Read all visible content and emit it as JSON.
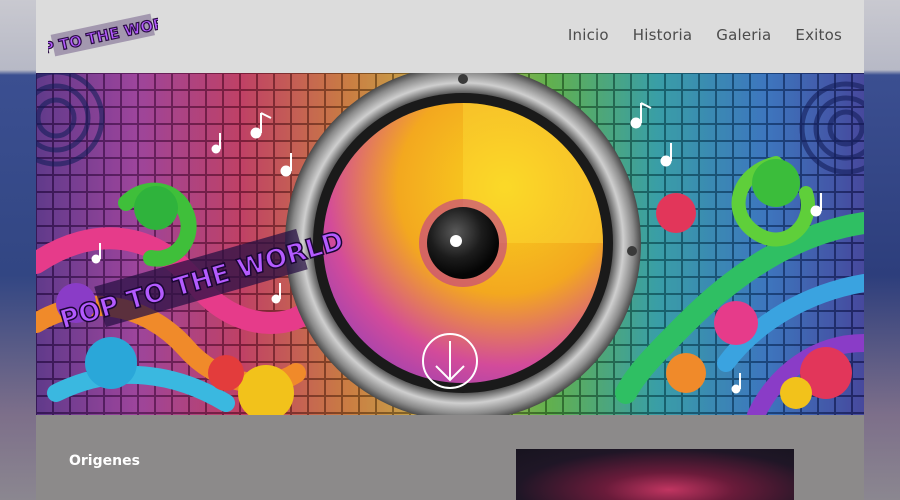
{
  "brand": {
    "logo_text": "POP TO THE WORLD"
  },
  "nav": {
    "items": [
      {
        "label": "Inicio"
      },
      {
        "label": "Historia"
      },
      {
        "label": "Galeria"
      },
      {
        "label": "Exitos"
      }
    ]
  },
  "hero": {
    "overlay_text": "POP TO THE WORLD",
    "scroll_icon": "arrow-down-circle-icon"
  },
  "main": {
    "section_title": "Origenes"
  },
  "colors": {
    "header_bg": "#dcdcdc",
    "nav_text": "#4c4c4c",
    "content_bg": "#8c8a8a",
    "logo_purple": "#9a3ad9",
    "speaker_yellow": "#f6c21c",
    "speaker_magenta": "#c0398f"
  }
}
